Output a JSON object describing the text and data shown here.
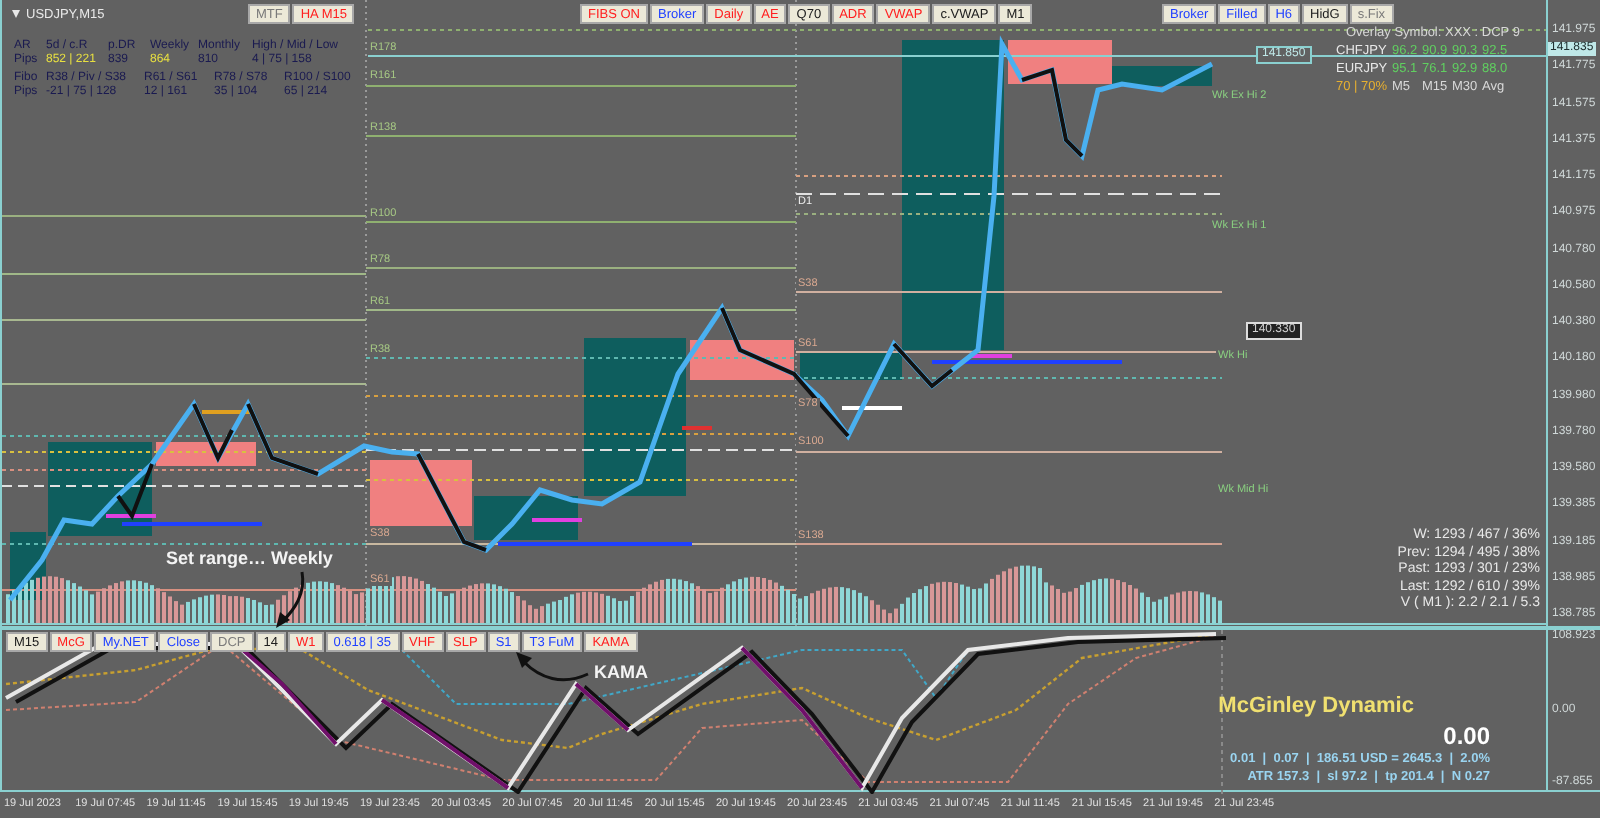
{
  "window": {
    "title": "USDJPY,M15"
  },
  "toolbar_left": [
    {
      "label": "MTF",
      "color": "#7a7a7a"
    },
    {
      "label": "HA M15",
      "color": "#ff2020"
    }
  ],
  "toolbar_center": [
    {
      "label": "FIBS ON",
      "color": "#ff2020"
    },
    {
      "label": "Broker",
      "color": "#2040ff"
    },
    {
      "label": "Daily",
      "color": "#ff2020"
    },
    {
      "label": "AE",
      "color": "#ff2020"
    },
    {
      "label": "Q70",
      "color": "#202020"
    },
    {
      "label": "ADR",
      "color": "#ff2020"
    },
    {
      "label": "VWAP",
      "color": "#ff2020"
    },
    {
      "label": "c.VWAP",
      "color": "#202020"
    },
    {
      "label": "M1",
      "color": "#202020"
    }
  ],
  "toolbar_right": [
    {
      "label": "Broker",
      "color": "#2040ff"
    },
    {
      "label": "Filled",
      "color": "#2040ff"
    },
    {
      "label": "H6",
      "color": "#2040ff"
    },
    {
      "label": "HidG",
      "color": "#202020"
    },
    {
      "label": "s.Fix",
      "color": "#7a7a7a"
    }
  ],
  "range_table": [
    [
      {
        "text": "AR",
        "highlighted": false
      },
      {
        "text": "5d / c.R",
        "highlighted": false
      },
      {
        "text": "p.DR",
        "highlighted": false
      },
      {
        "text": "Weekly",
        "highlighted": false
      },
      {
        "text": "Monthly",
        "highlighted": false
      },
      {
        "text": "High / Mid / Low",
        "highlighted": false
      }
    ],
    [
      {
        "text": "Pips",
        "highlighted": false
      },
      {
        "text": "852 | 221",
        "highlighted": true
      },
      {
        "text": "839",
        "highlighted": false
      },
      {
        "text": "864",
        "highlighted": true
      },
      {
        "text": "810",
        "highlighted": false
      },
      {
        "text": "4 | 75 | 158",
        "highlighted": false
      }
    ]
  ],
  "fibo_table": [
    [
      {
        "text": "Fibo",
        "highlighted": false
      },
      {
        "text": "R38 / Piv / S38",
        "highlighted": false
      },
      {
        "text": "R61 / S61",
        "highlighted": false
      },
      {
        "text": "R78 / S78",
        "highlighted": false
      },
      {
        "text": "R100 / S100",
        "highlighted": false
      }
    ],
    [
      {
        "text": "Pips",
        "highlighted": false
      },
      {
        "text": "-21 | 75 | 128",
        "highlighted": false
      },
      {
        "text": "12 | 161",
        "highlighted": false
      },
      {
        "text": "35 | 104",
        "highlighted": false
      },
      {
        "text": "65 | 214",
        "highlighted": false
      }
    ]
  ],
  "overlay": {
    "title": "Overlay Symbol: XXX : DCP 9",
    "rows": [
      {
        "symbol": "CHFJPY",
        "values": [
          "96.2",
          "90.9",
          "90.3",
          "92.5"
        ]
      },
      {
        "symbol": "EURJPY",
        "values": [
          "95.1",
          "76.1",
          "92.9",
          "88.0"
        ]
      }
    ],
    "summary": "70 | 70%",
    "columns": [
      "M5",
      "M15",
      "M30",
      "Avg"
    ]
  },
  "level_labels": [
    {
      "text": "R178",
      "kind": "resistance"
    },
    {
      "text": "R161",
      "kind": "resistance"
    },
    {
      "text": "R138",
      "kind": "resistance"
    },
    {
      "text": "R100",
      "kind": "resistance"
    },
    {
      "text": "R78",
      "kind": "resistance"
    },
    {
      "text": "R61",
      "kind": "resistance"
    },
    {
      "text": "R38",
      "kind": "resistance"
    },
    {
      "text": "S38",
      "kind": "support"
    },
    {
      "text": "S61",
      "kind": "support"
    },
    {
      "text": "D1",
      "kind": "daily"
    },
    {
      "text": "S38",
      "kind": "support"
    },
    {
      "text": "S61",
      "kind": "support"
    },
    {
      "text": "S78",
      "kind": "support"
    },
    {
      "text": "S100",
      "kind": "support"
    },
    {
      "text": "S138",
      "kind": "support"
    }
  ],
  "week_labels": [
    "Wk Ex Hi 2",
    "Wk Ex Hi 1",
    "Wk Hi",
    "Wk Mid Hi"
  ],
  "price_tags": [
    "141.850",
    "140.330"
  ],
  "current_price": "141.835",
  "price_axis": [
    "141.975",
    "141.775",
    "141.575",
    "141.375",
    "141.175",
    "140.975",
    "140.780",
    "140.580",
    "140.380",
    "140.180",
    "139.980",
    "139.780",
    "139.580",
    "139.385",
    "139.185",
    "138.985",
    "138.785"
  ],
  "stats": [
    "W: 1293 / 467 / 36%",
    "Prev: 1294 / 495 / 38%",
    "Past: 1293 / 301 / 23%",
    "Last: 1292 / 610 / 39%",
    "V ( M1 ): 2.2 / 2.1 / 5.3"
  ],
  "annotations": [
    "Set range… Weekly",
    "KAMA"
  ],
  "indicator_toolbar": [
    {
      "label": "M15",
      "color": "#202020"
    },
    {
      "label": "McG",
      "color": "#ff2020"
    },
    {
      "label": "My.NET",
      "color": "#2040ff"
    },
    {
      "label": "Close",
      "color": "#2040ff"
    },
    {
      "label": "DCP",
      "color": "#7a7a7a"
    },
    {
      "label": "14",
      "color": "#202020"
    },
    {
      "label": "W1",
      "color": "#ff2020"
    },
    {
      "label": "0.618 | 35",
      "color": "#2040ff"
    },
    {
      "label": "VHF",
      "color": "#ff2020"
    },
    {
      "label": "SLP",
      "color": "#ff2020"
    },
    {
      "label": "S1",
      "color": "#2040ff"
    },
    {
      "label": "T3 FuM",
      "color": "#2040ff"
    },
    {
      "label": "KAMA",
      "color": "#ff2020"
    }
  ],
  "indicator": {
    "title": "McGinley Dynamic",
    "value": "0.00",
    "details": [
      "0.01  |  0.07  |  186.51 USD = 2645.3  |  2.0%",
      "ATR 157.3  |  sl 97.2  |  tp 201.4  |  N 0.27"
    ],
    "axis": [
      "108.923",
      "0.00",
      "-87.855"
    ]
  },
  "time_axis": [
    "19 Jul 2023",
    "19 Jul 07:45",
    "19 Jul 11:45",
    "19 Jul 15:45",
    "19 Jul 19:45",
    "19 Jul 23:45",
    "20 Jul 03:45",
    "20 Jul 07:45",
    "20 Jul 11:45",
    "20 Jul 15:45",
    "20 Jul 19:45",
    "20 Jul 23:45",
    "21 Jul 03:45",
    "21 Jul 07:45",
    "21 Jul 11:45",
    "21 Jul 15:45",
    "21 Jul 19:45",
    "21 Jul 23:45"
  ]
}
